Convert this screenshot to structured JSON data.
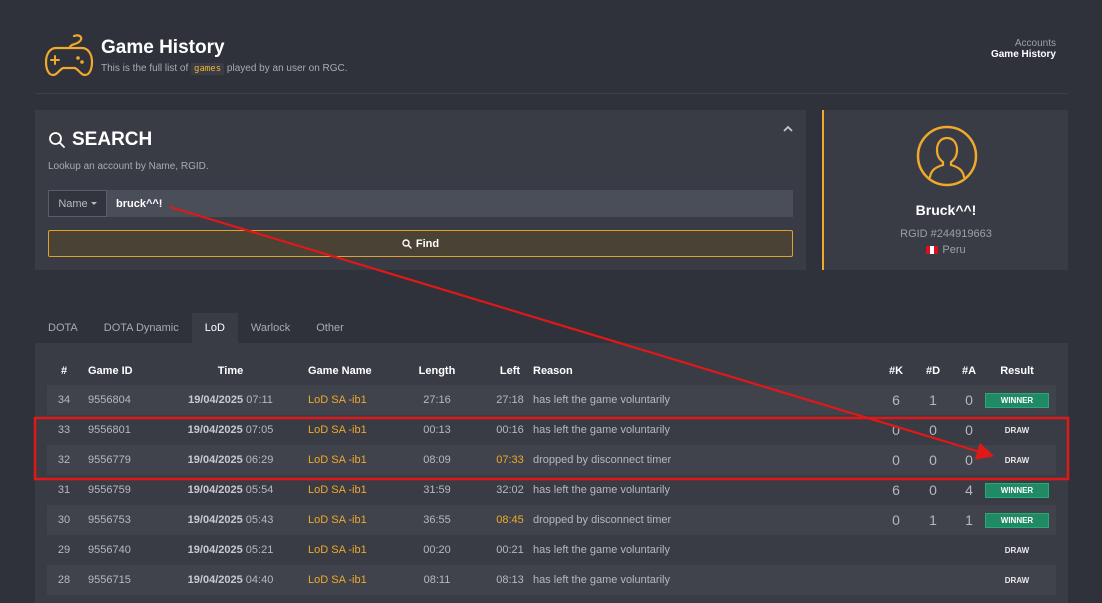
{
  "header": {
    "title": "Game History",
    "subtitle_prefix": "This is the full list of",
    "subtitle_code": "games",
    "subtitle_suffix": "played by an user on RGC."
  },
  "breadcrumb": {
    "parent": "Accounts",
    "current": "Game History"
  },
  "search": {
    "title": "SEARCH",
    "description": "Lookup an account by Name, RGID.",
    "type_selected": "Name",
    "value": "bruck^^!",
    "find_label": "Find"
  },
  "profile": {
    "name": "Bruck^^!",
    "rgid": "RGID #244919663",
    "country": "Peru"
  },
  "tabs": [
    "DOTA",
    "DOTA Dynamic",
    "LoD",
    "Warlock",
    "Other"
  ],
  "table": {
    "headers": {
      "num": "#",
      "gid": "Game ID",
      "time": "Time",
      "gname": "Game Name",
      "len": "Length",
      "left": "Left",
      "reason": "Reason",
      "k": "#K",
      "d": "#D",
      "a": "#A",
      "result": "Result"
    },
    "rows": [
      {
        "num": "34",
        "gid": "9556804",
        "date": "19/04/2025",
        "time": "07:11",
        "gname": "LoD SA -ib1",
        "len": "27:16",
        "left": "27:18",
        "reason": "has left the game voluntarily",
        "k": "6",
        "d": "1",
        "a": "0",
        "result": "WINNER"
      },
      {
        "num": "33",
        "gid": "9556801",
        "date": "19/04/2025",
        "time": "07:05",
        "gname": "LoD SA -ib1",
        "len": "00:13",
        "left": "00:16",
        "reason": "has left the game voluntarily",
        "k": "0",
        "d": "0",
        "a": "0",
        "result": "DRAW"
      },
      {
        "num": "32",
        "gid": "9556779",
        "date": "19/04/2025",
        "time": "06:29",
        "gname": "LoD SA -ib1",
        "len": "08:09",
        "left": "07:33",
        "reason": "dropped by disconnect timer",
        "k": "0",
        "d": "0",
        "a": "0",
        "result": "DRAW"
      },
      {
        "num": "31",
        "gid": "9556759",
        "date": "19/04/2025",
        "time": "05:54",
        "gname": "LoD SA -ib1",
        "len": "31:59",
        "left": "32:02",
        "reason": "has left the game voluntarily",
        "k": "6",
        "d": "0",
        "a": "4",
        "result": "WINNER"
      },
      {
        "num": "30",
        "gid": "9556753",
        "date": "19/04/2025",
        "time": "05:43",
        "gname": "LoD SA -ib1",
        "len": "36:55",
        "left": "08:45",
        "reason": "dropped by disconnect timer",
        "k": "0",
        "d": "1",
        "a": "1",
        "result": "WINNER"
      },
      {
        "num": "29",
        "gid": "9556740",
        "date": "19/04/2025",
        "time": "05:21",
        "gname": "LoD SA -ib1",
        "len": "00:20",
        "left": "00:21",
        "reason": "has left the game voluntarily",
        "k": "",
        "d": "",
        "a": "",
        "result": "DRAW"
      },
      {
        "num": "28",
        "gid": "9556715",
        "date": "19/04/2025",
        "time": "04:40",
        "gname": "LoD SA -ib1",
        "len": "08:11",
        "left": "08:13",
        "reason": "has left the game voluntarily",
        "k": "",
        "d": "",
        "a": "",
        "result": "DRAW"
      }
    ]
  },
  "colors": {
    "accent": "#f0a92b",
    "winner": "#1f8a63",
    "annotation": "#e01818",
    "background": "#2f323b",
    "panel": "#393c45"
  }
}
